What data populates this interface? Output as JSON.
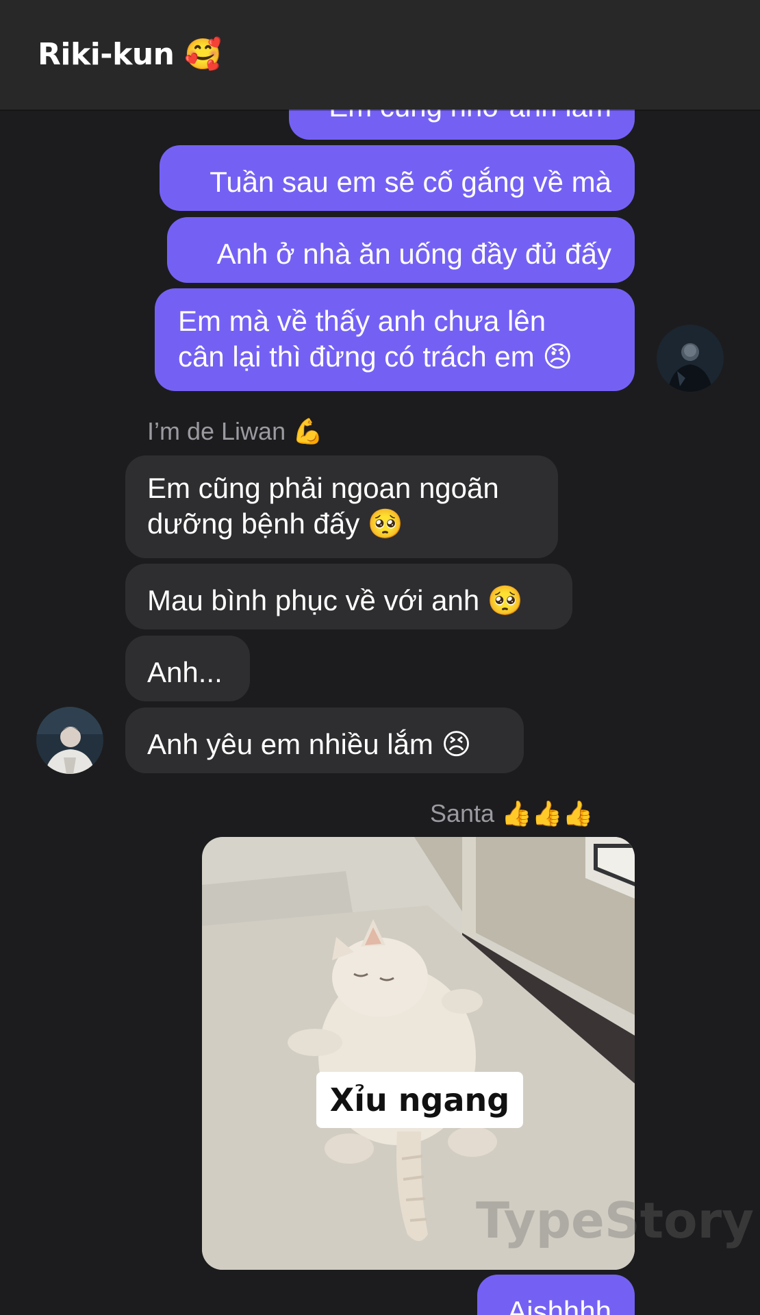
{
  "header": {
    "title": "Riki-kun",
    "title_emoji": "🥰"
  },
  "messages": {
    "out_partial": "Em cũng nhớ anh lắm",
    "out_1": "Tuần sau em sẽ cố gắng về mà",
    "out_2": "Anh ở nhà ăn uống đầy đủ đấy",
    "out_3_line1": "Em mà về thấy anh chưa lên",
    "out_3_line2": "cân lại thì đừng có trách em",
    "out_3_emoji": "😠",
    "in_sender": "I’m de Liwan",
    "in_sender_emoji": "💪",
    "in_1_line1": "Em cũng phải ngoan ngoãn",
    "in_1_line2": "dưỡng bệnh đấy",
    "in_1_emoji": "🥺",
    "in_2": "Mau bình phục về với anh",
    "in_2_emoji": "🥺",
    "in_3": "Anh...",
    "in_4": "Anh yêu em nhiều lắm",
    "in_4_emoji": "😣",
    "out_sender": "Santa",
    "out_sender_emoji": "👍👍👍",
    "out_last": "Aishhhh"
  },
  "photo": {
    "caption": "Xỉu ngang"
  },
  "watermark": "TypeStory",
  "colors": {
    "background": "#1c1c1e",
    "header": "#282829",
    "outgoing_bubble": "#7461f4",
    "incoming_bubble": "#2e2e30",
    "sender_text": "#9a9aa0"
  }
}
